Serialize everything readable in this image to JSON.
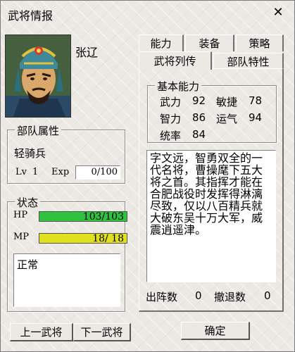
{
  "window": {
    "title": "武将情报",
    "close_label": "✕"
  },
  "general": {
    "name": "张辽"
  },
  "unit_attr": {
    "title": "部队属性",
    "type": "轻骑兵",
    "level_label": "Lv",
    "level": "1",
    "exp_label": "Exp",
    "exp_value": "0/100"
  },
  "status": {
    "title": "状态",
    "hp_label": "HP",
    "hp_text": "103/103",
    "hp_ratio": 1.0,
    "mp_label": "MP",
    "mp_text": "18/ 18",
    "mp_ratio": 1.0,
    "condition": "正常",
    "colors": {
      "hp": "#2fc23f",
      "mp": "#e0e020"
    }
  },
  "tabs": {
    "row1": [
      "能力",
      "装备",
      "策略"
    ],
    "row2": [
      "武将列传",
      "部队特性"
    ],
    "active": "武将列传"
  },
  "abilities": {
    "title": "基本能力",
    "wuli_label": "武力",
    "wuli": "92",
    "minjie_label": "敏捷",
    "minjie": "78",
    "zhili_label": "智力",
    "zhili": "86",
    "yunqi_label": "运气",
    "yunqi": "94",
    "tongshuai_label": "统率",
    "tongshuai": "84"
  },
  "biography": "字文远，智勇双全的一代名将，曹操麾下五大将之首。其指挥才能在合肥战役时发挥得淋漓尽致，仅以八百精兵就大破东吴十万大军，威震逍遥津。",
  "battle": {
    "sorties_label": "出阵数",
    "sorties": "0",
    "retreats_label": "撤退数",
    "retreats": "0"
  },
  "buttons": {
    "prev": "上一武将",
    "next": "下一武将",
    "ok": "确定"
  }
}
